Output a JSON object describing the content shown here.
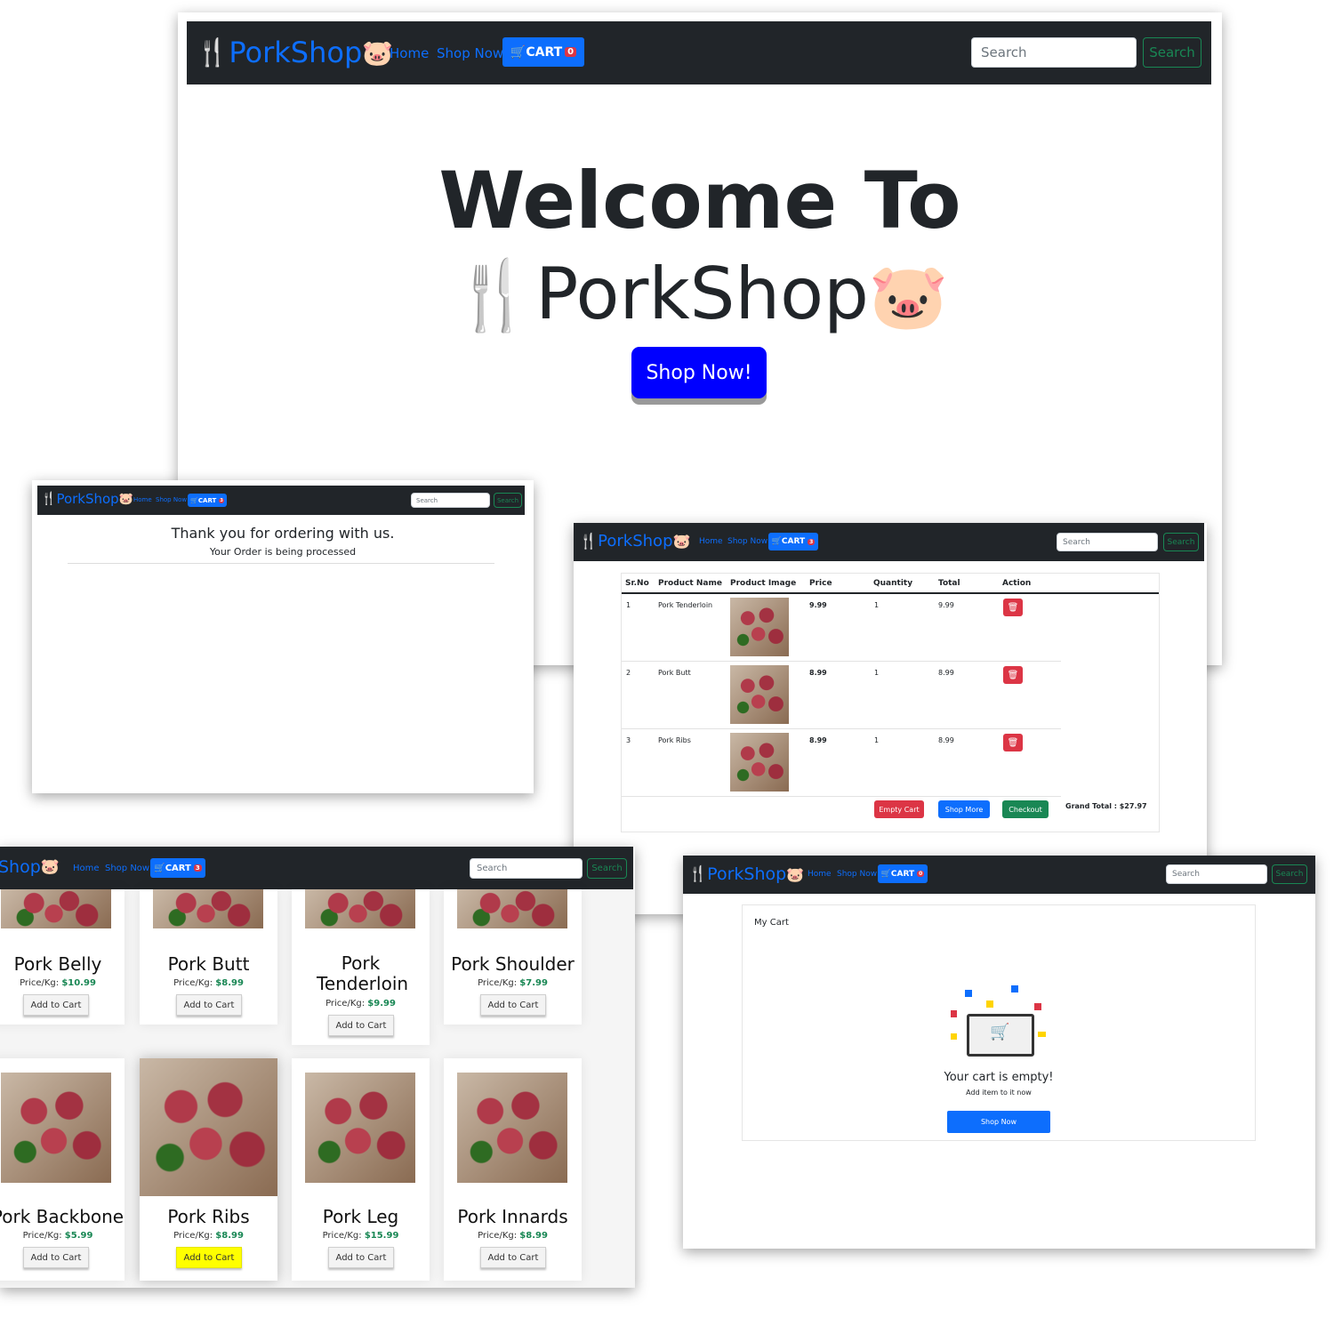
{
  "brand": {
    "name": "PorkShop"
  },
  "nav": {
    "home": "Home",
    "shop_now": "Shop Now",
    "cart_label": "CART",
    "search_placeholder": "Search",
    "search_button": "Search"
  },
  "hero": {
    "cart_count": "0",
    "welcome": "Welcome To",
    "brand_big": "PorkShop",
    "shop_button": "Shop Now!"
  },
  "thankyou": {
    "cart_count": "3",
    "title": "Thank you for ordering with us.",
    "subtitle": "Your Order is being processed"
  },
  "cart_table": {
    "cart_count": "3",
    "headers": [
      "Sr.No",
      "Product Name",
      "Product Image",
      "Price",
      "Quantity",
      "Total",
      "Action"
    ],
    "rows": [
      {
        "sr": "1",
        "name": "Pork Tenderloin",
        "price": "9.99",
        "qty": "1",
        "total": "9.99"
      },
      {
        "sr": "2",
        "name": "Pork Butt",
        "price": "8.99",
        "qty": "1",
        "total": "8.99"
      },
      {
        "sr": "3",
        "name": "Pork Ribs",
        "price": "8.99",
        "qty": "1",
        "total": "8.99"
      }
    ],
    "empty_cart": "Empty Cart",
    "shop_more": "Shop More",
    "checkout": "Checkout",
    "grand_total": "Grand Total : $27.97"
  },
  "products": {
    "cart_count": "3",
    "brand_partial": "Shop",
    "price_label": "Price/Kg:",
    "add_to_cart": "Add to Cart",
    "items": [
      {
        "name": "Pork Belly",
        "price": "$10.99"
      },
      {
        "name": "Pork Butt",
        "price": "$8.99"
      },
      {
        "name": "Pork Tenderloin",
        "price": "$9.99"
      },
      {
        "name": "Pork Shoulder",
        "price": "$7.99"
      },
      {
        "name": "Pork Backbone",
        "price": "$5.99"
      },
      {
        "name": "Pork Ribs",
        "price": "$8.99"
      },
      {
        "name": "Pork Leg",
        "price": "$15.99"
      },
      {
        "name": "Pork Innards",
        "price": "$8.99"
      }
    ],
    "highlight_color": "#ffff00"
  },
  "empty_cart": {
    "cart_count": "0",
    "title": "My Cart",
    "message": "Your cart is empty!",
    "sub": "Add item to it now",
    "button": "Shop Now"
  },
  "colors": {
    "nav_bg": "#212529",
    "primary": "#0d6efd",
    "danger": "#dc3545",
    "success": "#198754",
    "hero_button": "#0000ff"
  }
}
